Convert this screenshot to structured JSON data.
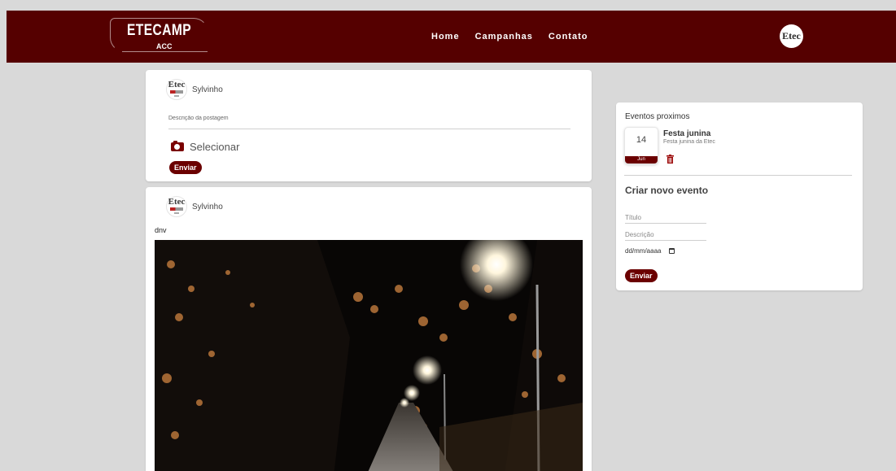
{
  "header": {
    "logo_title": "ETECAMP",
    "logo_subtitle": "ACC",
    "nav": [
      "Home",
      "Campanhas",
      "Contato"
    ]
  },
  "avatar_text": "Etec",
  "new_post": {
    "author": "Sylvinho",
    "description_placeholder": "Descrição da postagem",
    "select_label": "Selecionar",
    "submit_label": "Enviar"
  },
  "post": {
    "author": "Sylvinho",
    "text": "dnv"
  },
  "events": {
    "title": "Eventos proximos",
    "items": [
      {
        "day": "14",
        "month": "Jun",
        "name": "Festa junina",
        "description": "Festa junina da Etec"
      }
    ],
    "create_title": "Criar novo evento",
    "title_placeholder": "Título",
    "description_placeholder": "Descrição",
    "date_placeholder": "dd/mm/aaaa",
    "submit_label": "Enviar"
  },
  "colors": {
    "primary": "#550000",
    "button": "#6b0000",
    "background": "#d9d9d9"
  }
}
